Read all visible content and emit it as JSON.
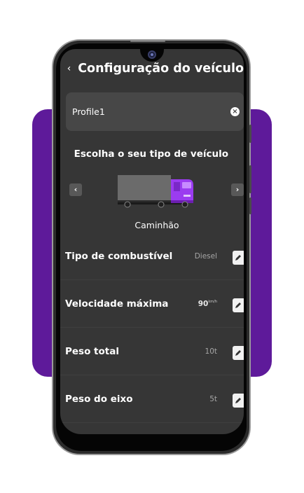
{
  "header": {
    "back_icon": "‹",
    "title": "Configuração do veículo"
  },
  "profile": {
    "name": "Profile1",
    "clear_icon": "×"
  },
  "vehicle_selector": {
    "heading": "Escolha o seu tipo de veículo",
    "prev_icon": "‹",
    "next_icon": "›",
    "selected_vehicle": "Caminhão"
  },
  "settings": [
    {
      "label": "Tipo de combustível",
      "value": "Diesel"
    },
    {
      "label": "Velocidade máxima",
      "value": "90",
      "unit": "km/h"
    },
    {
      "label": "Peso total",
      "value": "10t"
    },
    {
      "label": "Peso do eixo",
      "value": "5t"
    }
  ],
  "colors": {
    "accent_purple": "#5e1a9a",
    "truck_cab": "#9b3cf0",
    "screen_bg": "#363636",
    "card_bg": "#474747"
  }
}
